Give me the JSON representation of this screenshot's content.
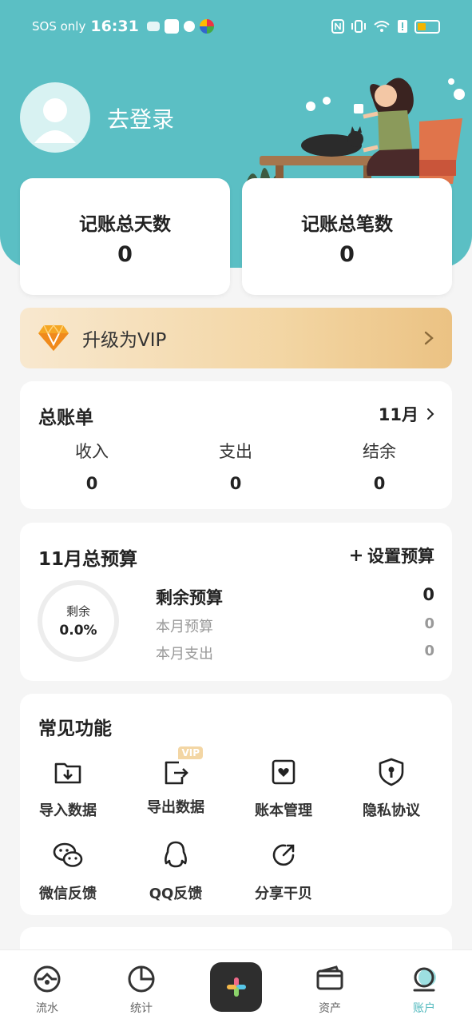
{
  "status_bar": {
    "carrier": "SOS only",
    "time": "16:31"
  },
  "profile": {
    "login_label": "去登录"
  },
  "stats": {
    "total_days_label": "记账总天数",
    "total_days_value": "0",
    "total_entries_label": "记账总笔数",
    "total_entries_value": "0"
  },
  "vip_banner": {
    "label": "升级为VIP"
  },
  "bill": {
    "title": "总账单",
    "month": "11月",
    "income_label": "收入",
    "income_value": "0",
    "expense_label": "支出",
    "expense_value": "0",
    "balance_label": "结余",
    "balance_value": "0"
  },
  "budget": {
    "title": "11月总预算",
    "set_label": "设置预算",
    "ring_label": "剩余",
    "ring_percent": "0.0%",
    "remaining_label": "剩余预算",
    "remaining_value": "0",
    "monthly_budget_label": "本月预算",
    "monthly_budget_value": "0",
    "monthly_spend_label": "本月支出",
    "monthly_spend_value": "0"
  },
  "functions": {
    "title": "常见功能",
    "vip_badge": "VIP",
    "items": [
      {
        "label": "导入数据",
        "icon": "import-folder-icon"
      },
      {
        "label": "导出数据",
        "icon": "export-icon"
      },
      {
        "label": "账本管理",
        "icon": "ledger-heart-icon"
      },
      {
        "label": "隐私协议",
        "icon": "privacy-shield-icon"
      },
      {
        "label": "微信反馈",
        "icon": "wechat-icon"
      },
      {
        "label": "QQ反馈",
        "icon": "qq-icon"
      },
      {
        "label": "分享干贝",
        "icon": "share-icon"
      }
    ]
  },
  "tabbar": {
    "tabs": [
      {
        "label": "流水",
        "icon": "flow-icon"
      },
      {
        "label": "统计",
        "icon": "pie-chart-icon"
      },
      {
        "label": "资产",
        "icon": "wallet-icon"
      },
      {
        "label": "账户",
        "icon": "account-icon",
        "active": true
      }
    ]
  },
  "colors": {
    "header": "#5bbfc4",
    "active_tab": "#4fb8bd",
    "vip_gold": "#ebc283"
  }
}
